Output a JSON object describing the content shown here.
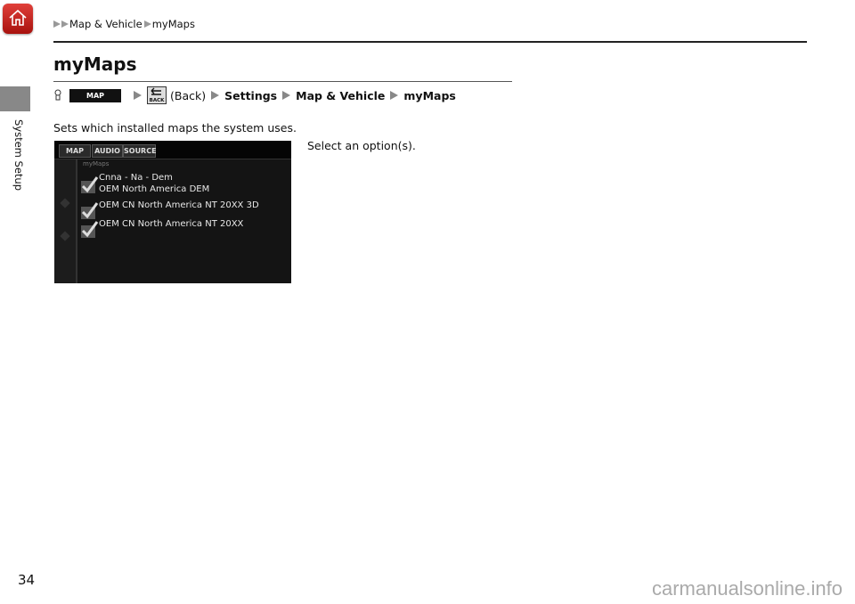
{
  "breadcrumb": {
    "items": [
      "Map & Vehicle",
      "myMaps"
    ]
  },
  "sidebar": {
    "section_label": "System Setup"
  },
  "page": {
    "title": "myMaps",
    "nav_path": {
      "map_button": "MAP",
      "back_button": "BACK",
      "back_label": "(Back)",
      "steps": [
        "Settings",
        "Map & Vehicle",
        "myMaps"
      ]
    },
    "description": "Sets which installed maps the system uses.",
    "callout": "Select an option(s).",
    "page_number": "34"
  },
  "screen": {
    "tabs": [
      "MAP",
      "AUDIO",
      "SOURCE"
    ],
    "header": "myMaps",
    "items": [
      {
        "line1": "Cnna - Na - Dem",
        "line2": "OEM North America DEM",
        "checked": true
      },
      {
        "line1": "OEM CN North America NT 20XX 3D",
        "checked": true
      },
      {
        "line1": "OEM CN North America NT 20XX",
        "checked": true
      }
    ]
  },
  "watermark": "carmanualsonline.info"
}
